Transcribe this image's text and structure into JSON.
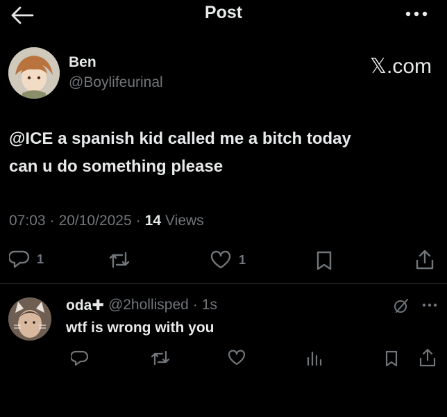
{
  "header": {
    "title": "Post"
  },
  "post": {
    "author_name": "Ben",
    "author_handle": "@Boylifeurinal",
    "watermark": "𝕏.com",
    "text_line1": "@ICE a spanish kid called me a bitch today",
    "text_line2": "can u do something please",
    "time": "07:03",
    "date": "20/10/2025",
    "views_count": "14",
    "views_label": "Views",
    "reply_count": "1",
    "like_count": "1"
  },
  "reply": {
    "author_name": "oda✚",
    "author_handle": "@2hollisped",
    "time": "1s",
    "text": "wtf is wrong with you"
  },
  "separator": "·",
  "icons": {
    "back": "arrow-left-icon",
    "more": "more-horizontal-icon",
    "reply": "reply-icon",
    "retweet": "retweet-icon",
    "like": "heart-icon",
    "bookmark": "bookmark-icon",
    "share": "share-icon",
    "views": "analytics-icon",
    "grok": "grok-icon"
  },
  "colors": {
    "background": "#000000",
    "text": "#e7e9ea",
    "secondary": "#71767b",
    "divider": "#2f3336"
  }
}
